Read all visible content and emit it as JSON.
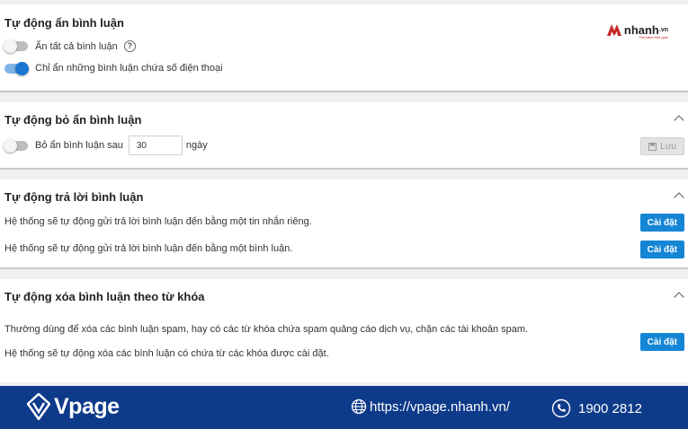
{
  "sections": {
    "hide": {
      "title": "Tự động ẩn bình luận",
      "option_all": "Ẩn tất cả bình luận",
      "help_glyph": "?",
      "option_phone": "Chỉ ẩn những bình luận chứa số điện thoại"
    },
    "unhide": {
      "title": "Tự động bỏ ẩn bình luận",
      "label_before": "Bỏ ẩn bình luận sau",
      "input_value": "30",
      "label_after": "ngày",
      "save_label": "Lưu"
    },
    "reply": {
      "title": "Tự động trả lời bình luận",
      "line_message": "Hệ thống sẽ tự động gửi trả lời bình luận đến bằng một tin nhắn riêng.",
      "line_comment": "Hệ thống sẽ tự động gửi trả lời bình luận đến bằng một bình luận.",
      "button_label": "Cài đặt"
    },
    "delete": {
      "title": "Tự động xóa bình luận theo từ khóa",
      "desc1": "Thường dùng để xóa các bình luận spam, hay có các từ khóa chứa spam quảng cáo dịch vụ, chặn các tài khoản spam.",
      "desc2": "Hệ thống sẽ tự động xóa các bình luận có chứa từ các khóa được cài đặt.",
      "button_label": "Cài đặt"
    }
  },
  "brand": {
    "name": "nhanh",
    "suffix": ".vn",
    "tagline": "Tiết kiệm thời gian"
  },
  "footer": {
    "logo_text": "Vpage",
    "url": "https://vpage.nhanh.vn/",
    "phone": "1900 2812"
  },
  "colors": {
    "primary": "#1586d5",
    "footer_bg": "#0e3a8a",
    "brand_red": "#c62828"
  }
}
